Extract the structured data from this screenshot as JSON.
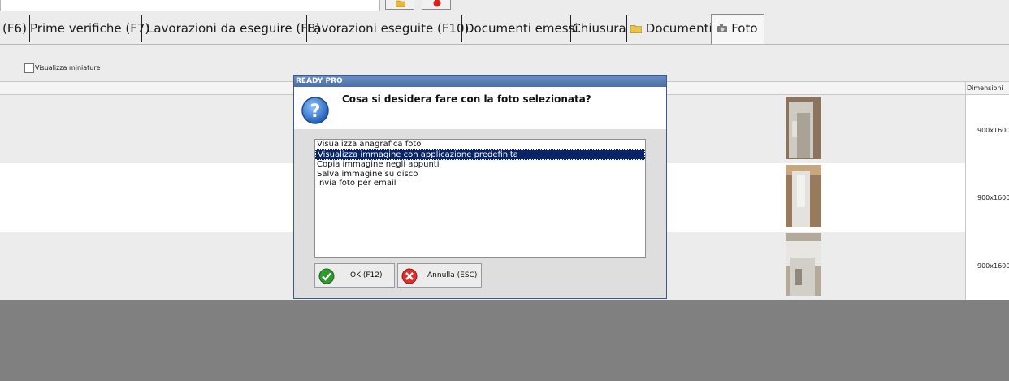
{
  "tabs": [
    {
      "label": "(F6)"
    },
    {
      "label": "Prime verifiche (F7)"
    },
    {
      "label": "Lavorazioni da eseguire (F8)"
    },
    {
      "label": "Lavorazioni eseguite  (F10)"
    },
    {
      "label": "Documenti emessi"
    },
    {
      "label": "Chiusura"
    },
    {
      "label": "Documenti",
      "icon": "folder-icon"
    },
    {
      "label": "Foto",
      "icon": "camera-icon",
      "active": true
    }
  ],
  "toolbar": {
    "thumbnail_checkbox_label": "Visualizza miniature",
    "checked": false
  },
  "grid": {
    "column_header": "Dimensioni",
    "rows": [
      {
        "dimension": "900x1600"
      },
      {
        "dimension": "900x1600"
      },
      {
        "dimension": "900x1600"
      }
    ]
  },
  "dialog": {
    "title": "READY PRO",
    "message": "Cosa si desidera fare con la foto selezionata?",
    "options": [
      "Visualizza anagrafica foto",
      "Visualizza immagine con applicazione predefinita",
      "Copia immagine negli appunti",
      "Salva immagine su disco",
      "Invia foto per email"
    ],
    "selected_index": 1,
    "ok_label": "OK (F12)",
    "cancel_label": "Annulla (ESC)"
  },
  "colors": {
    "dialog_title": "#4a6ea8",
    "selection": "#0a246a",
    "background_overlay": "#808080"
  }
}
